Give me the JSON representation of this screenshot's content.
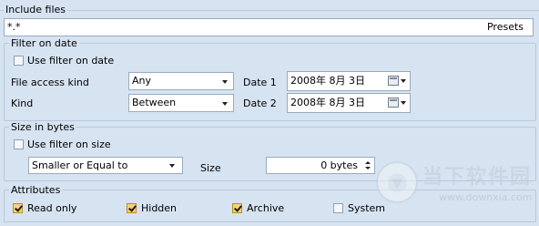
{
  "include_files": {
    "legend": "Include files",
    "pattern_value": "*.*",
    "presets_label": "Presets"
  },
  "filter_on_date": {
    "legend": "Filter on date",
    "use_filter_label": "Use filter on date",
    "use_filter_checked": false,
    "access_kind_label": "File access kind",
    "access_kind_value": "Any",
    "kind_label": "Kind",
    "kind_value": "Between",
    "date1_label": "Date 1",
    "date1_value": "2008年  8月  3日",
    "date2_label": "Date 2",
    "date2_value": "2008年  8月  3日"
  },
  "size_in_bytes": {
    "legend": "Size in bytes",
    "use_filter_label": "Use filter on size",
    "use_filter_checked": false,
    "comparison_value": "Smaller or Equal to",
    "size_label": "Size",
    "size_value": "0 bytes"
  },
  "attributes": {
    "legend": "Attributes",
    "items": [
      {
        "label": "Read only",
        "checked": true
      },
      {
        "label": "Hidden",
        "checked": true
      },
      {
        "label": "Archive",
        "checked": true
      },
      {
        "label": "System",
        "checked": false
      }
    ]
  },
  "watermark": {
    "brand_text": "当下软件园",
    "url_text": "www.downxia.com"
  },
  "colors": {
    "background": "#d6e3f1",
    "border": "#b7c9de",
    "checkbox_checked": "#f3d27a"
  }
}
